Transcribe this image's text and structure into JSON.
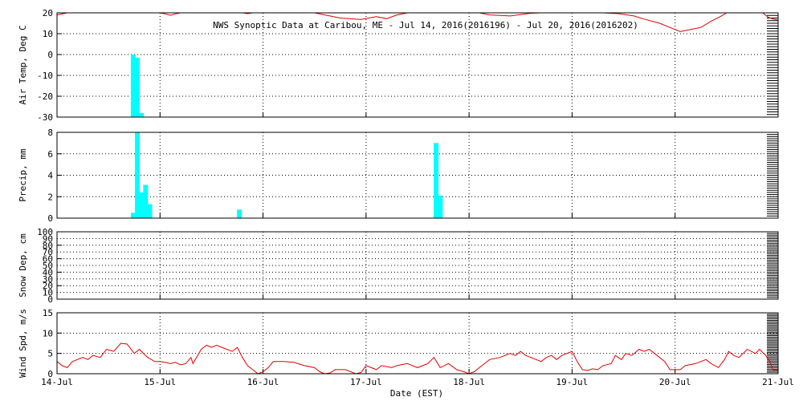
{
  "colors": {
    "background": "#ffffff",
    "axes": "#000000",
    "bar": "#00ffff",
    "line": "#e00000"
  },
  "chart_data": {
    "title": "NWS Synoptic Data at Caribou, ME - Jul 14, 2016(2016196) - Jul 20, 2016(2016202)",
    "type": "multi-panel time series",
    "xlabel": "Date (EST)",
    "x_ticks": [
      "14-Jul",
      "15-Jul",
      "16-Jul",
      "17-Jul",
      "18-Jul",
      "19-Jul",
      "20-Jul",
      "21-Jul"
    ],
    "xlim_days": [
      0,
      7
    ],
    "grid": true,
    "panels": [
      {
        "ylabel": "Air Temp, Deg C",
        "ylim": [
          -30,
          20
        ],
        "yticks": [
          "-30",
          "-20",
          "-10",
          "0",
          "10",
          "20"
        ],
        "series": [
          {
            "type": "bar",
            "color": "#00ffff",
            "points": [
              [
                0.74,
                0.0
              ],
              [
                0.78,
                -1.5
              ],
              [
                0.82,
                -28.0
              ]
            ]
          },
          {
            "type": "line",
            "color": "#e00000",
            "points": [
              [
                0.0,
                19.0
              ],
              [
                0.05,
                19.5
              ],
              [
                0.1,
                20.0
              ],
              [
                1.0,
                20.0
              ],
              [
                1.05,
                19.5
              ],
              [
                1.1,
                18.8
              ],
              [
                1.15,
                19.5
              ],
              [
                1.2,
                20.0
              ],
              [
                1.8,
                20.0
              ],
              [
                1.85,
                19.6
              ],
              [
                1.9,
                20.0
              ],
              [
                2.5,
                20.0
              ],
              [
                2.6,
                19.0
              ],
              [
                2.75,
                17.5
              ],
              [
                2.95,
                16.8
              ],
              [
                3.1,
                18.2
              ],
              [
                3.2,
                17.2
              ],
              [
                3.3,
                19.0
              ],
              [
                3.4,
                20.0
              ],
              [
                4.1,
                20.0
              ],
              [
                4.2,
                19.0
              ],
              [
                4.4,
                18.5
              ],
              [
                4.6,
                19.8
              ],
              [
                4.7,
                20.0
              ],
              [
                5.3,
                20.0
              ],
              [
                5.45,
                19.6
              ],
              [
                5.6,
                18.5
              ],
              [
                5.7,
                17.0
              ],
              [
                5.85,
                15.0
              ],
              [
                6.0,
                12.0
              ],
              [
                6.05,
                11.0
              ],
              [
                6.15,
                12.0
              ],
              [
                6.25,
                13.0
              ],
              [
                6.35,
                16.0
              ],
              [
                6.45,
                18.5
              ],
              [
                6.5,
                20.0
              ],
              [
                6.85,
                20.0
              ],
              [
                6.9,
                18.0
              ],
              [
                6.95,
                17.0
              ],
              [
                7.0,
                16.5
              ]
            ]
          }
        ]
      },
      {
        "ylabel": "Precip, mm",
        "ylim": [
          0,
          8
        ],
        "yticks": [
          "0",
          "2",
          "4",
          "6",
          "8"
        ],
        "series": [
          {
            "type": "bar",
            "color": "#00ffff",
            "points": [
              [
                0.74,
                0.5
              ],
              [
                0.78,
                8.0
              ],
              [
                0.82,
                2.4
              ],
              [
                0.86,
                3.1
              ],
              [
                0.9,
                1.3
              ],
              [
                1.77,
                0.8
              ],
              [
                3.68,
                7.0
              ],
              [
                3.72,
                2.1
              ]
            ]
          }
        ]
      },
      {
        "ylabel": "Snow Dep, cm",
        "ylim": [
          0,
          100
        ],
        "yticks": [
          "0",
          "20",
          "40",
          "60",
          "80",
          "100"
        ],
        "yticks_minor": [
          "10",
          "30",
          "50",
          "70",
          "90"
        ],
        "series": []
      },
      {
        "ylabel": "Wind Spd, m/s",
        "ylim": [
          0,
          15
        ],
        "yticks": [
          "0",
          "5",
          "10",
          "15"
        ],
        "series": [
          {
            "type": "line",
            "color": "#e00000",
            "points": [
              [
                0.0,
                3.0
              ],
              [
                0.05,
                2.0
              ],
              [
                0.1,
                1.5
              ],
              [
                0.15,
                3.0
              ],
              [
                0.25,
                4.0
              ],
              [
                0.3,
                3.5
              ],
              [
                0.35,
                4.5
              ],
              [
                0.42,
                4.0
              ],
              [
                0.48,
                6.0
              ],
              [
                0.55,
                5.5
              ],
              [
                0.62,
                7.5
              ],
              [
                0.68,
                7.3
              ],
              [
                0.75,
                5.0
              ],
              [
                0.8,
                6.0
              ],
              [
                0.88,
                4.0
              ],
              [
                0.95,
                3.0
              ],
              [
                1.0,
                3.0
              ],
              [
                1.05,
                2.8
              ],
              [
                1.1,
                2.5
              ],
              [
                1.15,
                2.8
              ],
              [
                1.2,
                2.2
              ],
              [
                1.25,
                2.5
              ],
              [
                1.3,
                4.0
              ],
              [
                1.32,
                2.5
              ],
              [
                1.4,
                6.0
              ],
              [
                1.45,
                7.0
              ],
              [
                1.5,
                6.5
              ],
              [
                1.55,
                7.0
              ],
              [
                1.6,
                6.5
              ],
              [
                1.7,
                5.5
              ],
              [
                1.75,
                6.5
              ],
              [
                1.8,
                4.0
              ],
              [
                1.85,
                2.0
              ],
              [
                1.9,
                1.0
              ],
              [
                1.95,
                0.0
              ],
              [
                2.0,
                0.5
              ],
              [
                2.05,
                1.5
              ],
              [
                2.1,
                3.0
              ],
              [
                2.2,
                3.0
              ],
              [
                2.3,
                2.8
              ],
              [
                2.4,
                2.0
              ],
              [
                2.5,
                1.5
              ],
              [
                2.55,
                0.5
              ],
              [
                2.6,
                0.0
              ],
              [
                2.65,
                0.2
              ],
              [
                2.7,
                1.0
              ],
              [
                2.8,
                1.0
              ],
              [
                2.9,
                0.0
              ],
              [
                2.95,
                0.3
              ],
              [
                3.0,
                2.0
              ],
              [
                3.1,
                1.0
              ],
              [
                3.15,
                2.0
              ],
              [
                3.25,
                1.5
              ],
              [
                3.3,
                2.0
              ],
              [
                3.4,
                2.5
              ],
              [
                3.5,
                1.5
              ],
              [
                3.6,
                2.5
              ],
              [
                3.66,
                4.0
              ],
              [
                3.72,
                1.5
              ],
              [
                3.8,
                2.5
              ],
              [
                3.88,
                1.0
              ],
              [
                3.95,
                0.5
              ],
              [
                4.0,
                0.0
              ],
              [
                4.05,
                0.5
              ],
              [
                4.1,
                1.5
              ],
              [
                4.2,
                3.5
              ],
              [
                4.3,
                4.0
              ],
              [
                4.4,
                5.0
              ],
              [
                4.45,
                4.5
              ],
              [
                4.5,
                5.5
              ],
              [
                4.55,
                4.5
              ],
              [
                4.6,
                4.0
              ],
              [
                4.7,
                3.0
              ],
              [
                4.75,
                4.0
              ],
              [
                4.8,
                4.5
              ],
              [
                4.85,
                3.5
              ],
              [
                4.9,
                4.5
              ],
              [
                4.95,
                5.0
              ],
              [
                5.0,
                5.5
              ],
              [
                5.05,
                3.0
              ],
              [
                5.1,
                1.0
              ],
              [
                5.15,
                0.8
              ],
              [
                5.2,
                1.2
              ],
              [
                5.25,
                1.0
              ],
              [
                5.3,
                2.0
              ],
              [
                5.38,
                2.5
              ],
              [
                5.42,
                4.5
              ],
              [
                5.48,
                3.5
              ],
              [
                5.52,
                5.0
              ],
              [
                5.58,
                4.5
              ],
              [
                5.65,
                6.0
              ],
              [
                5.7,
                5.5
              ],
              [
                5.75,
                6.0
              ],
              [
                5.8,
                5.0
              ],
              [
                5.9,
                3.0
              ],
              [
                5.95,
                1.0
              ],
              [
                6.05,
                1.0
              ],
              [
                6.1,
                2.0
              ],
              [
                6.2,
                2.5
              ],
              [
                6.3,
                3.5
              ],
              [
                6.35,
                2.5
              ],
              [
                6.42,
                1.5
              ],
              [
                6.48,
                3.5
              ],
              [
                6.52,
                5.5
              ],
              [
                6.57,
                4.5
              ],
              [
                6.62,
                4.0
              ],
              [
                6.7,
                6.0
              ],
              [
                6.78,
                5.0
              ],
              [
                6.82,
                6.0
              ],
              [
                6.88,
                4.5
              ],
              [
                6.92,
                3.0
              ],
              [
                6.95,
                1.0
              ],
              [
                7.0,
                1.0
              ]
            ]
          }
        ]
      }
    ]
  }
}
